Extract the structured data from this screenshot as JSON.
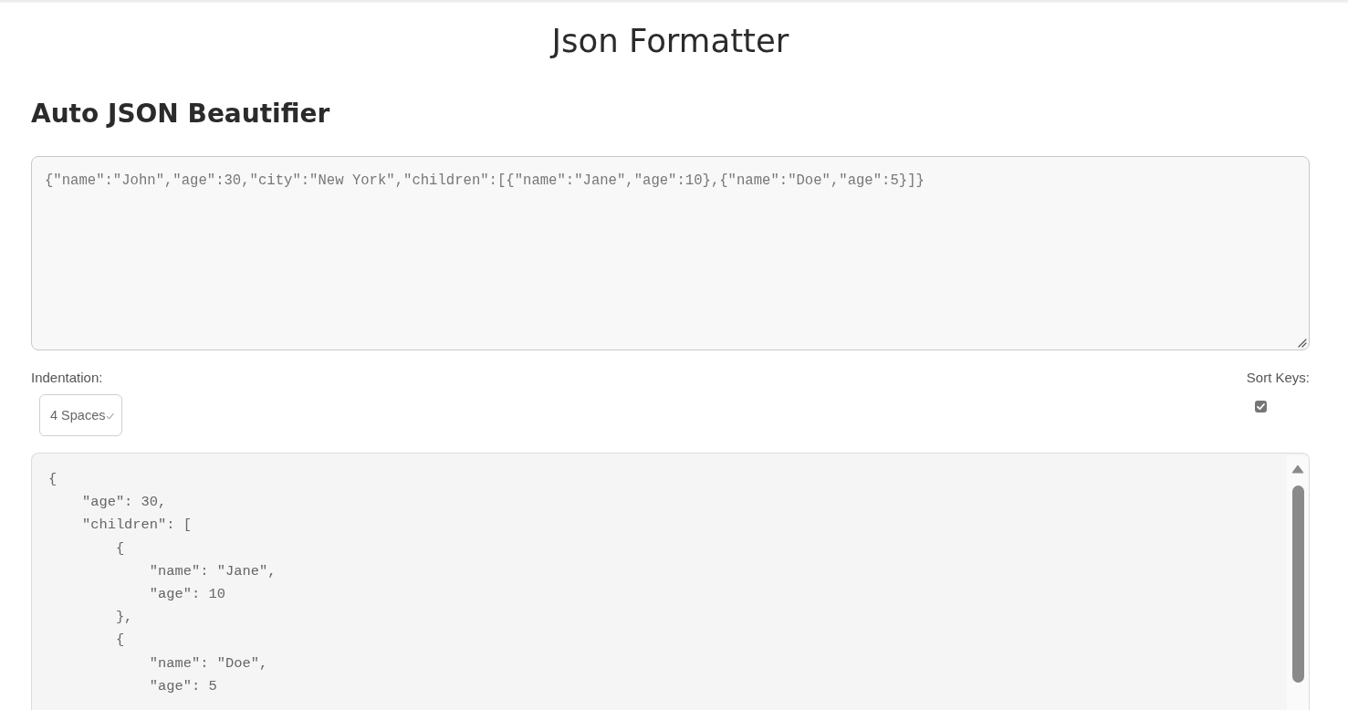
{
  "page": {
    "title": "Json Formatter"
  },
  "heading": "Auto JSON Beautifier",
  "input": {
    "value": "{\"name\":\"John\",\"age\":30,\"city\":\"New York\",\"children\":[{\"name\":\"Jane\",\"age\":10},{\"name\":\"Doe\",\"age\":5}]}"
  },
  "options": {
    "indentation": {
      "label": "Indentation:",
      "value": "4 Spaces"
    },
    "sort_keys": {
      "label": "Sort Keys:",
      "checked": true
    }
  },
  "output": {
    "value": "{\n    \"age\": 30,\n    \"children\": [\n        {\n            \"name\": \"Jane\",\n            \"age\": 10\n        },\n        {\n            \"name\": \"Doe\",\n            \"age\": 5"
  }
}
